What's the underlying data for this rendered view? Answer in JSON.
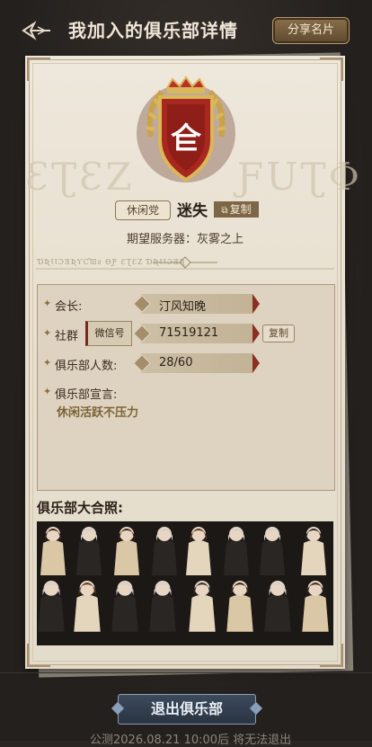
{
  "header": {
    "title": "我加入的俱乐部详情",
    "share_label": "分享名片"
  },
  "club": {
    "tag": "休闲党",
    "name": "迷失",
    "copy_label": "复制",
    "server_label": "期望服务器：",
    "server_value": "灰雾之上"
  },
  "info": {
    "leader_label": "会长:",
    "leader_value": "汀风知晚",
    "community_label": "社群",
    "wechat_label": "微信号",
    "community_value": "71519121",
    "copy_label": "复制",
    "members_label": "俱乐部人数:",
    "members_value": "28/60",
    "declaration_label": "俱乐部宣言:",
    "declaration_value": "休闲活跃不压力"
  },
  "photo": {
    "title": "俱乐部大合照:"
  },
  "footer": {
    "exit_label": "退出俱乐部",
    "notice": "公测2026.08.21 10:00后 将无法退出"
  },
  "colors": {
    "accent_gold": "#b89a6a",
    "accent_red": "#8b2f22",
    "exit_button": "#2a3442"
  }
}
